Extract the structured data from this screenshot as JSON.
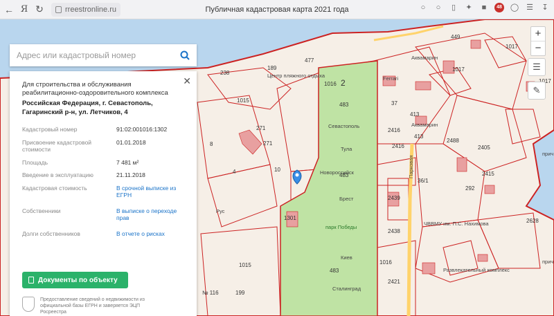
{
  "browser": {
    "url": "rreestronline.ru",
    "title": "Публичная кадастровая карта 2021 года",
    "logo": "Я"
  },
  "search": {
    "placeholder": "Адрес или кадастровый номер"
  },
  "panel": {
    "purpose": "Для строительства и обслуживания реабилитационно-оздоровительного комплекса",
    "address": "Российская Федерация, г. Севастополь, Гагаринский р-н, ул. Летчиков, 4",
    "rows": [
      {
        "key": "Кадастровый номер",
        "value": "91:02:001016:1302",
        "link": false
      },
      {
        "key": "Присвоение кадастровой стоимости",
        "value": "01.01.2018",
        "link": false
      },
      {
        "key": "Площадь",
        "value": "7 481 м²",
        "link": false
      },
      {
        "key": "Введение в эксплуатацию",
        "value": "21.11.2018",
        "link": false
      },
      {
        "key": "Кадастровая стоимость",
        "value": "В срочной выписке из ЕГРН",
        "link": true
      },
      {
        "key": "Собственники",
        "value": "В выписке о переходе прав",
        "link": true
      },
      {
        "key": "Долги собственников",
        "value": "В отчете о рисках",
        "link": true
      }
    ],
    "doc_button": "Документы по объекту",
    "footer": "Предоставление сведений о недвижимости из официальной базы ЕГРН и заверяется ЭЦП Росреестра"
  },
  "map": {
    "labels": {
      "l1016a": "1016",
      "l2": "2",
      "l1015": "1015",
      "l271a": "271",
      "l271b": "271",
      "l8": "8",
      "l4": "4",
      "l483a": "483",
      "l483b": "483",
      "l483c": "483",
      "l1016b": "1016",
      "l2439": "2439",
      "l2438": "2438",
      "l2421": "2421",
      "l2416a": "2416",
      "l2416b": "2416",
      "l413a": "413",
      "l413b": "413",
      "l37": "37",
      "l1017a": "1017",
      "l1017b": "1017",
      "l1017c": "1017",
      "l292": "292",
      "l2628": "2628",
      "l36": "36/1",
      "l1015b": "1015",
      "l199": "199",
      "l477": "477",
      "l189": "189",
      "l238": "238",
      "l1301": "1301",
      "l449": "449",
      "l2488": "2488",
      "l2405": "2405",
      "l2415": "2415",
      "l10": "10",
      "l116": "№ 116"
    },
    "pois": {
      "sevastopol": "Севастополь",
      "tula": "Тула",
      "novorossiysk": "Новороссийск",
      "brest": "Брест",
      "park": "парк Победы",
      "kiev": "Киев",
      "stalingrad": "Сталинград",
      "akvamarin": "Аквамарин",
      "akvamarin2": "Аквамарин",
      "vvmu": "ЧВВМУ им. П.С. Нахимова",
      "razvlek": "Развлекательный комплекс",
      "street": "Парковая",
      "centre": "Центр пляжного отдыха",
      "ferrari": "Ferrari",
      "prich1": "прич",
      "prich2": "прич",
      "rus": "Рус"
    }
  }
}
